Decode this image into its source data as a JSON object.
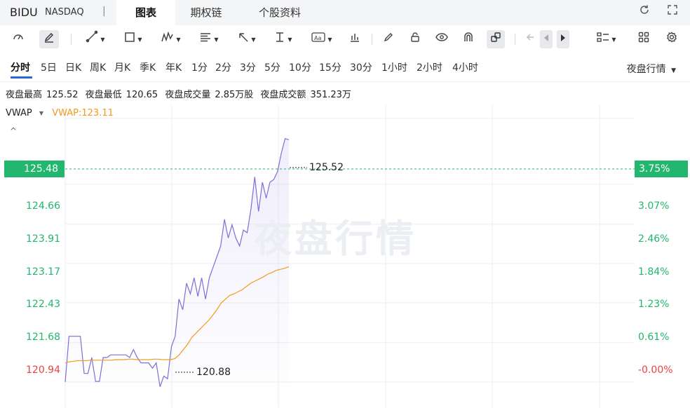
{
  "header": {
    "symbol": "BIDU",
    "exchange": "NASDAQ",
    "separator": "|",
    "tabs": [
      {
        "label": "图表",
        "active": true
      },
      {
        "label": "期权链",
        "active": false
      },
      {
        "label": "个股资料",
        "active": false
      }
    ],
    "icons": [
      "refresh-icon",
      "fullscreen-icon"
    ]
  },
  "toolbar": {
    "tools": [
      "indicator-icon",
      "draw-icon",
      "line-icon",
      "rect-icon",
      "pattern-icon",
      "fib-icon",
      "arrow-icon",
      "measure-icon",
      "text-icon",
      "bars-icon",
      "pen-icon",
      "lock-icon",
      "eye-icon",
      "magnet-icon",
      "link-icon",
      "back-icon",
      "prev-icon",
      "next-icon",
      "layout-icon",
      "grid-icon",
      "settings-icon"
    ]
  },
  "periods": {
    "items": [
      "分时",
      "5日",
      "日K",
      "周K",
      "月K",
      "季K",
      "年K",
      "1分",
      "2分",
      "3分",
      "5分",
      "10分",
      "15分",
      "30分",
      "1小时",
      "2小时",
      "4小时"
    ],
    "active": "分时",
    "session": "夜盘行情",
    "session_caret": "▼"
  },
  "stats": {
    "high_label": "夜盘最高",
    "high": "125.52",
    "low_label": "夜盘最低",
    "low": "120.65",
    "volume_label": "夜盘成交量",
    "volume": "2.85万股",
    "amount_label": "夜盘成交额",
    "amount": "351.23万"
  },
  "indicator": {
    "name": "VWAP",
    "caret": "▼",
    "value_text": "VWAP:123.11",
    "collapse": "^"
  },
  "chart_data": {
    "type": "line",
    "watermark": "夜盘行情",
    "price_axis": [
      "124.66",
      "123.91",
      "123.17",
      "122.43",
      "121.68",
      "120.94"
    ],
    "pct_axis": [
      "3.07%",
      "2.46%",
      "1.84%",
      "1.23%",
      "0.61%",
      "-0.00%"
    ],
    "current_price": "125.48",
    "current_pct": "3.75%",
    "high_annotation": "125.52",
    "low_annotation": "120.88",
    "ylim": [
      120.45,
      126.15
    ],
    "reference_price": 120.94,
    "series": [
      {
        "name": "price",
        "color": "#7b6fd9",
        "values": [
          120.94,
          121.8,
          121.8,
          121.8,
          121.8,
          121.1,
          121.1,
          121.4,
          120.95,
          120.95,
          121.4,
          121.4,
          121.45,
          121.45,
          121.45,
          121.45,
          121.45,
          121.4,
          121.55,
          121.4,
          121.3,
          121.3,
          121.3,
          121.2,
          121.3,
          120.85,
          121.05,
          121.0,
          121.6,
          121.8,
          122.5,
          122.3,
          122.8,
          122.6,
          122.9,
          122.55,
          122.9,
          122.5,
          122.9,
          123.1,
          123.3,
          123.5,
          124.0,
          123.65,
          123.9,
          123.65,
          123.5,
          123.8,
          123.75,
          124.2,
          124.8,
          124.15,
          124.7,
          124.4,
          124.7,
          124.75,
          124.9,
          125.25,
          125.52,
          125.5
        ]
      },
      {
        "name": "VWAP",
        "color": "#f39a1e",
        "values": [
          121.3,
          121.32,
          121.33,
          121.34,
          121.34,
          121.34,
          121.35,
          121.35,
          121.35,
          121.35,
          121.35,
          121.35,
          121.36,
          121.36,
          121.36,
          121.37,
          121.37,
          121.36,
          121.36,
          121.36,
          121.36,
          121.37,
          121.37,
          121.36,
          121.36,
          121.36,
          121.38,
          121.45,
          121.55,
          121.65,
          121.78,
          121.86,
          121.94,
          122.02,
          122.1,
          122.2,
          122.31,
          122.43,
          122.5,
          122.57,
          122.6,
          122.64,
          122.68,
          122.74,
          122.8,
          122.84,
          122.88,
          122.92,
          122.97,
          123.0,
          123.04,
          123.06,
          123.08,
          123.11
        ]
      }
    ]
  }
}
